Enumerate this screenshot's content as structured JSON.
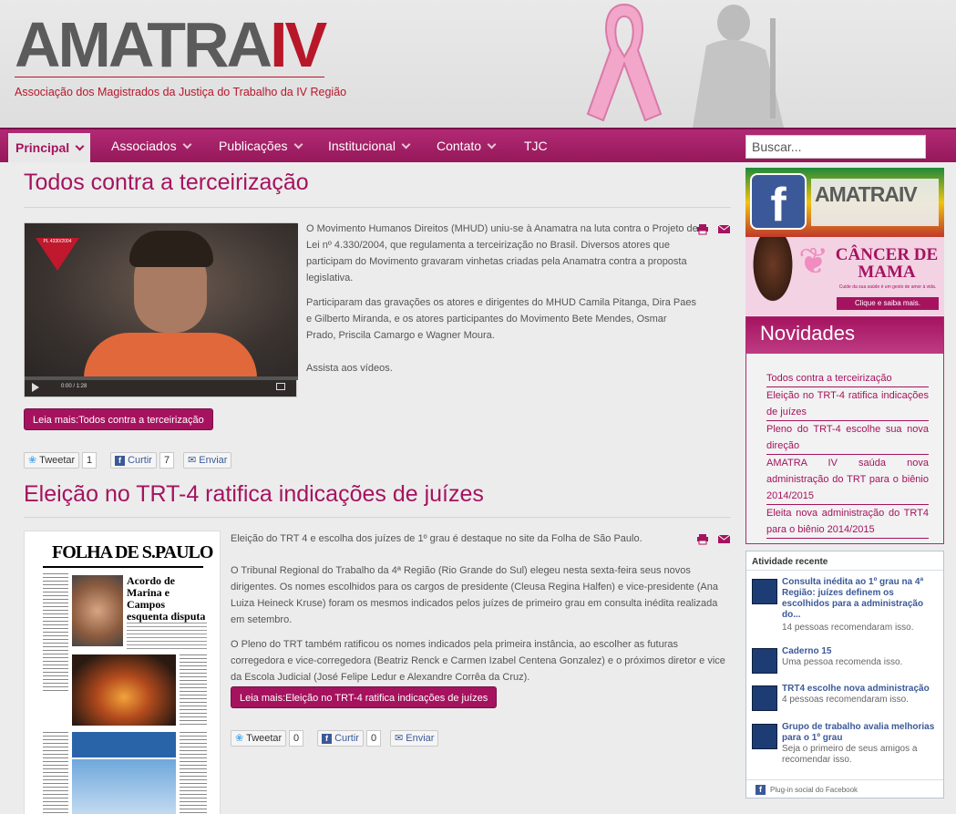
{
  "header": {
    "logo_text": "AMATRA",
    "logo_iv": "IV",
    "logo_subtitle": "Associação dos Magistrados da Justiça do Trabalho da IV Região"
  },
  "nav": {
    "items": [
      {
        "label": "Principal",
        "dropdown": true
      },
      {
        "label": "Associados",
        "dropdown": true
      },
      {
        "label": "Publicações",
        "dropdown": true
      },
      {
        "label": "Institucional",
        "dropdown": true
      },
      {
        "label": "Contato",
        "dropdown": true
      },
      {
        "label": "TJC",
        "dropdown": false
      }
    ],
    "search_placeholder": "Buscar..."
  },
  "articles": [
    {
      "title": "Todos contra a terceirização",
      "video_badge": "PL 4330/2004",
      "video_time": "0:00 / 1:28",
      "paragraphs": [
        "O Movimento Humanos Direitos (MHUD) uniu-se à Anamatra na luta contra o Projeto de Lei nº 4.330/2004, que regulamenta a terceirização no Brasil. Diversos atores que participam do Movimento gravaram vinhetas criadas pela Anamatra contra a proposta legislativa.",
        "Participaram das gravações os atores e dirigentes do MHUD Camila Pitanga, Dira Paes e Gilberto Miranda, e os atores participantes do Movimento Bete Mendes, Osmar Prado, Priscila Camargo e Wagner Moura.",
        "Assista aos vídeos."
      ],
      "read_more": "Leia mais:Todos contra a terceirização",
      "share": {
        "tweet": "Tweetar",
        "tweet_count": "1",
        "like": "Curtir",
        "like_count": "7",
        "send": "Enviar"
      }
    },
    {
      "title": "Eleição no TRT-4 ratifica indicações de juízes",
      "newspaper_name": "FOLHA DE S.PAULO",
      "newspaper_headline": "Acordo de Marina e Campos esquenta disputa por alianças",
      "paragraphs": [
        "Eleição do TRT 4 e escolha dos juízes de 1º grau é destaque no site da Folha de São Paulo.",
        "O Tribunal Regional do Trabalho da 4ª Região (Rio Grande do Sul) elegeu nesta sexta-feira seus novos dirigentes. Os nomes escolhidos para os cargos de presidente (Cleusa Regina Halfen) e vice-presidente (Ana Luiza Heineck Kruse) foram os mesmos indicados pelos juízes de primeiro grau em consulta inédita realizada em setembro.",
        "O Pleno do TRT também ratificou os nomes indicados pela primeira instância, ao escolher as futuras corregedora e vice-corregedora (Beatriz Renck e Carmen Izabel Centena Gonzalez) e o próximos diretor e vice da Escola Judicial (José Felipe Ledur e Alexandre Corrêa da Cruz)."
      ],
      "read_more": "Leia mais:Eleição no TRT-4 ratifica indicações de juízes",
      "share": {
        "tweet": "Tweetar",
        "tweet_count": "0",
        "like": "Curtir",
        "like_count": "0",
        "send": "Enviar"
      }
    }
  ],
  "sidebar": {
    "fb_banner_text": "AMATRAIV",
    "cancer_banner": {
      "title": "CÂNCER DE MAMA",
      "sub": "Cuide da sua saúde é um gesto de amor à vida.",
      "cta": "Clique e saiba mais."
    },
    "novidades_title": "Novidades",
    "novidades": [
      "Todos contra a terceirização",
      "Eleição no TRT-4 ratifica indicações de juízes",
      "Pleno do TRT-4 escolhe sua nova direção",
      "AMATRA IV saúda nova administração do TRT para o biênio 2014/2015",
      "Eleita nova administração do TRT4 para o biênio 2014/2015"
    ],
    "activity_title": "Atividade recente",
    "activity": [
      {
        "title": "Consulta inédita ao 1º grau na 4ª Região: juízes definem os escolhidos para a administração do...",
        "meta": "14 pessoas recomendaram isso."
      },
      {
        "title": "Caderno 15",
        "meta": "Uma pessoa recomenda isso."
      },
      {
        "title": "TRT4 escolhe nova administração",
        "meta": "4 pessoas recomendaram isso."
      },
      {
        "title": "Grupo de trabalho avalia melhorias para o 1º grau",
        "meta": "Seja o primeiro de seus amigos a recomendar isso."
      }
    ],
    "social_plugin": "Plug-in social do Facebook"
  },
  "colors": {
    "accent": "#a5135f",
    "nav": "#96185a",
    "logo_red": "#b8172a"
  }
}
